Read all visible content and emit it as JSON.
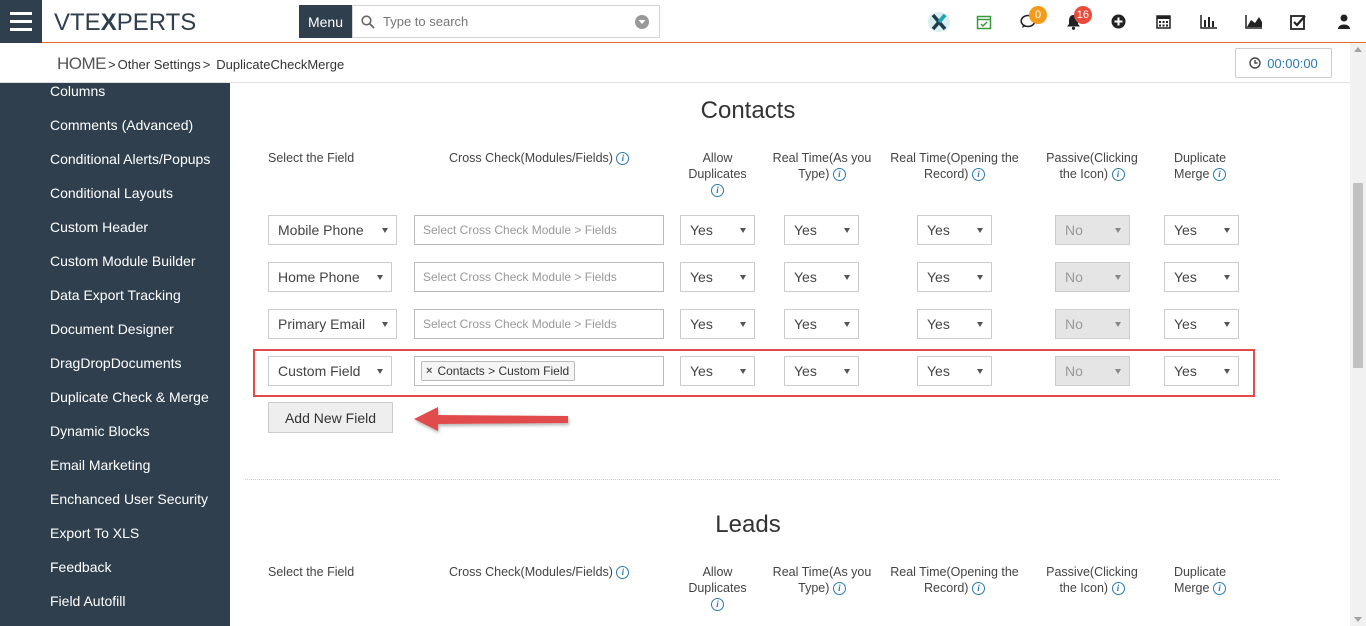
{
  "topbar": {
    "logo_pre": "VTE",
    "logo_x": "X",
    "logo_post": "PERTS",
    "menu_label": "Menu",
    "search_placeholder": "Type to search",
    "chat_badge": "0",
    "notif_badge": "16"
  },
  "breadcrumb": {
    "home": "HOME",
    "level1": "Other Settings",
    "level2": "DuplicateCheckMerge",
    "sep": ">"
  },
  "timer": "00:00:00",
  "sidebar": {
    "items": [
      "Columns",
      "Comments (Advanced)",
      "Conditional Alerts/Popups",
      "Conditional Layouts",
      "Custom Header",
      "Custom Module Builder",
      "Data Export Tracking",
      "Document Designer",
      "DragDropDocuments",
      "Duplicate Check & Merge",
      "Dynamic Blocks",
      "Email Marketing",
      "Enchanced User Security",
      "Export To XLS",
      "Feedback",
      "Field Autofill"
    ]
  },
  "columns": {
    "select_field": "Select the Field",
    "cross_check": "Cross Check(Modules/Fields)",
    "allow_dup_1": "Allow",
    "allow_dup_2": "Duplicates",
    "rt_type_1": "Real Time(As you",
    "rt_type_2": "Type)",
    "rt_open_1": "Real Time(Opening the",
    "rt_open_2": "Record)",
    "passive_1": "Passive(Clicking",
    "passive_2": "the Icon)",
    "dup_merge_1": "Duplicate",
    "dup_merge_2": "Merge"
  },
  "contacts": {
    "title": "Contacts",
    "cc_placeholder": "Select Cross Check Module > Fields",
    "rows": [
      {
        "field": "Mobile Phone",
        "allow": "Yes",
        "rt_type": "Yes",
        "rt_open": "Yes",
        "passive": "No",
        "merge": "Yes"
      },
      {
        "field": "Home Phone",
        "allow": "Yes",
        "rt_type": "Yes",
        "rt_open": "Yes",
        "passive": "No",
        "merge": "Yes"
      },
      {
        "field": "Primary Email",
        "allow": "Yes",
        "rt_type": "Yes",
        "rt_open": "Yes",
        "passive": "No",
        "merge": "Yes"
      },
      {
        "field": "Custom Field",
        "tag": "Contacts > Custom Field",
        "allow": "Yes",
        "rt_type": "Yes",
        "rt_open": "Yes",
        "passive": "No",
        "merge": "Yes"
      }
    ],
    "add_button": "Add New Field"
  },
  "leads": {
    "title": "Leads"
  },
  "info_glyph": "i",
  "tag_remove": "×",
  "colors": {
    "sidebar_bg": "#2f3f4e",
    "accent_orange": "#e96c2b",
    "highlight_red": "#e24b4b",
    "link_blue": "#2a7ab0"
  }
}
